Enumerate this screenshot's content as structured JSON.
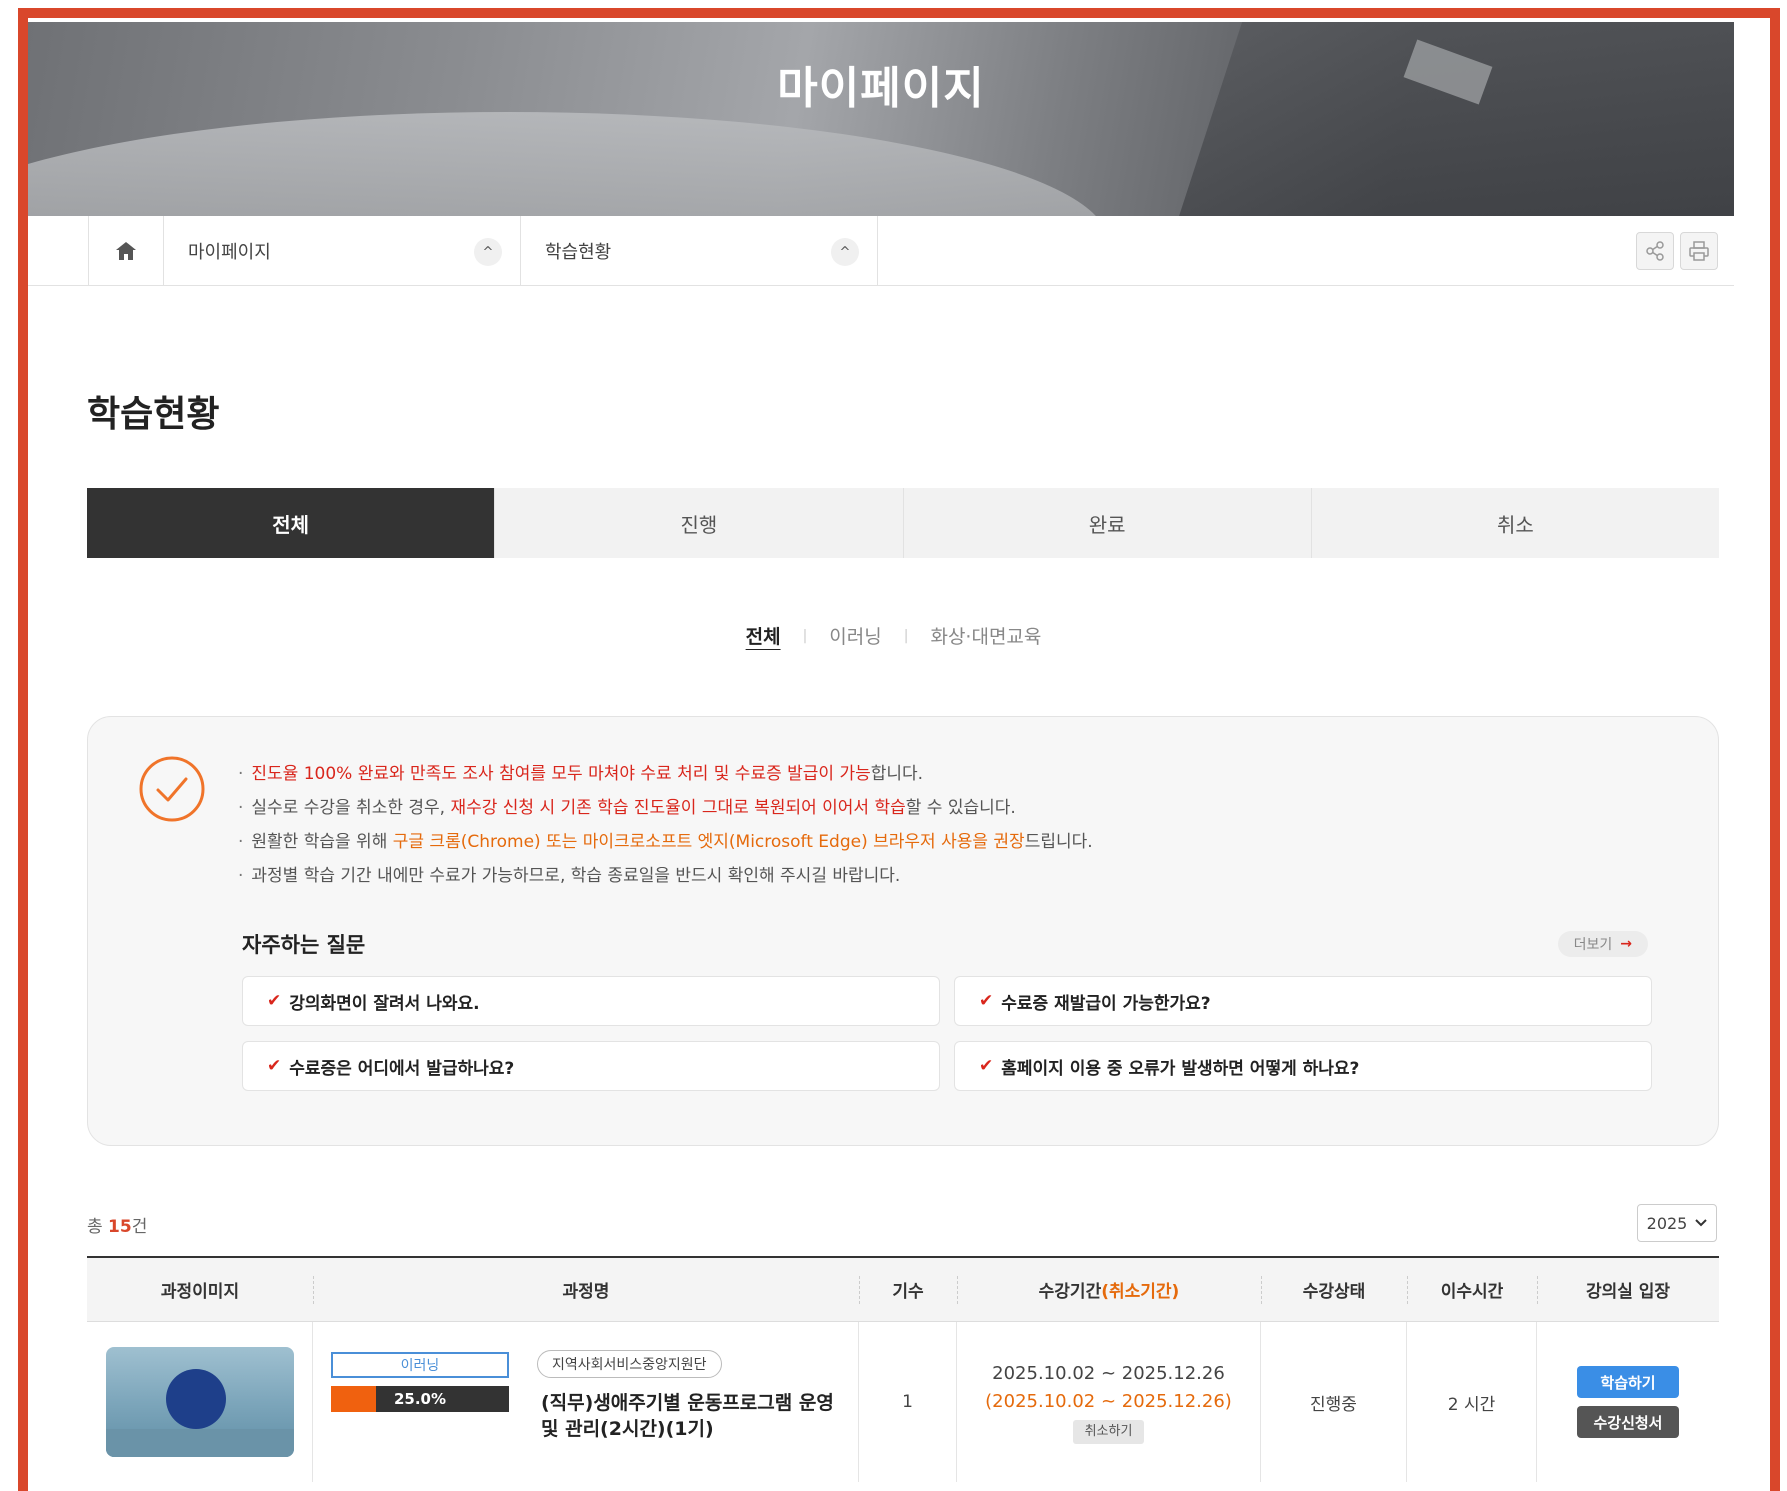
{
  "hero": {
    "title": "마이페이지"
  },
  "breadcrumb": {
    "items": [
      {
        "label": "마이페이지"
      },
      {
        "label": "학습현황"
      }
    ]
  },
  "section_title": "학습현황",
  "main_tabs": [
    {
      "label": "전체",
      "active": true
    },
    {
      "label": "진행",
      "active": false
    },
    {
      "label": "완료",
      "active": false
    },
    {
      "label": "취소",
      "active": false
    }
  ],
  "sub_tabs": [
    {
      "label": "전체",
      "active": true
    },
    {
      "label": "이러닝",
      "active": false
    },
    {
      "label": "화상·대면교육",
      "active": false
    }
  ],
  "notice": {
    "line1_red": "진도율 100% 완료와 만족도 조사 참여를 모두 마쳐야 수료 처리 및 수료증 발급이 가능",
    "line1_rest": "합니다.",
    "line2_pre": "실수로 수강을 취소한 경우, ",
    "line2_red": "재수강 신청 시 기존 학습 진도율이 그대로 복원되어 이어서 학습",
    "line2_rest": "할 수 있습니다.",
    "line3_pre": "원활한 학습을 위해 ",
    "line3_orange": "구글 크롬(Chrome) 또는 마이크로소프트 엣지(Microsoft Edge) 브라우저 사용을 권장",
    "line3_rest": "드립니다.",
    "line4": "과정별 학습 기간 내에만 수료가 가능하므로, 학습 종료일을 반드시 확인해 주시길 바랍니다."
  },
  "faq": {
    "title": "자주하는 질문",
    "more_label": "더보기",
    "items": [
      "강의화면이 잘려서 나와요.",
      "수료증 재발급이 가능한가요?",
      "수료증은 어디에서 발급하나요?",
      "홈페이지 이용 중 오류가 발생하면 어떻게 하나요?"
    ]
  },
  "list": {
    "total_prefix": "총 ",
    "total_count": "15",
    "total_suffix": "건",
    "year": "2025"
  },
  "table": {
    "headers": {
      "image": "과정이미지",
      "name": "과정명",
      "term": "기수",
      "period": "수강기간",
      "period_cancel": "(취소기간)",
      "status": "수강상태",
      "hours": "이수시간",
      "enter": "강의실 입장"
    },
    "rows": [
      {
        "type": "이러닝",
        "progress_label": "25.0%",
        "progress": 0.25,
        "org": "지역사회서비스중앙지원단",
        "name": "(직무)생애주기별 운동프로그램 운영 및 관리(2시간)(1기)",
        "term": "1",
        "period": "2025.10.02 ~ 2025.12.26",
        "cancel_period": "(2025.10.02 ~ 2025.12.26)",
        "cancel_btn": "취소하기",
        "status": "진행중",
        "hours": "2 시간",
        "study_btn": "학습하기",
        "app_btn": "수강신청서"
      }
    ]
  },
  "colors": {
    "accent_red": "#d9261c",
    "accent_orange": "#e56a0c",
    "frame": "#d9472b",
    "tab_active": "#333333",
    "study_button": "#3a8ee6"
  }
}
